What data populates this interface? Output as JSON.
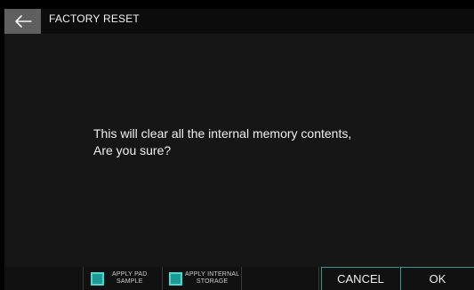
{
  "header": {
    "back_icon": "arrow-left-icon",
    "title": "FACTORY RESET"
  },
  "dialog": {
    "line1": "This will clear all the internal memory contents,",
    "line2": "Are you sure?"
  },
  "options": [
    {
      "label_line1": "APPLY PAD",
      "label_line2": "SAMPLE",
      "checked": true
    },
    {
      "label_line1": "APPLY INTERNAL",
      "label_line2": "STORAGE",
      "checked": true
    }
  ],
  "buttons": {
    "cancel": "CANCEL",
    "ok": "OK"
  },
  "colors": {
    "accent": "#2f9a97",
    "checkbox_fill": "#1e9a95",
    "back_button": "#5f5f5f"
  }
}
